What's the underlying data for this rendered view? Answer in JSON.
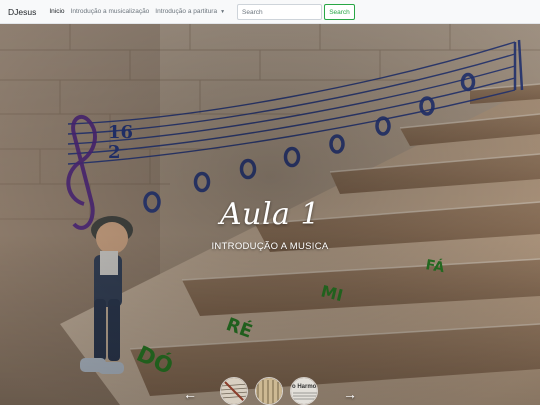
{
  "navbar": {
    "brand": "DJesus",
    "links": [
      "Inicio",
      "Introdução a musicalização"
    ],
    "dropdown_label": "Introdução a partitura",
    "dropdown_icon": "caret-down-icon",
    "search": {
      "placeholder": "Search",
      "button_label": "Search"
    }
  },
  "carousel": {
    "title": "Aula 1",
    "subtitle": "INTRODUÇÃO A MUSICA",
    "prev_icon": "arrow-left-icon",
    "next_icon": "arrow-right-icon",
    "stair_words": [
      "DÓ",
      "RÉ",
      "MI",
      "FÁ"
    ],
    "time_signature": {
      "top": "16",
      "bottom": "2"
    },
    "thumbnail_text": "o Harmo"
  },
  "colors": {
    "search_accent": "#28a745",
    "stair_letters": "#2f8a2a",
    "staff_lines": "#2a3e8c",
    "clef": "#5b2e8f"
  }
}
